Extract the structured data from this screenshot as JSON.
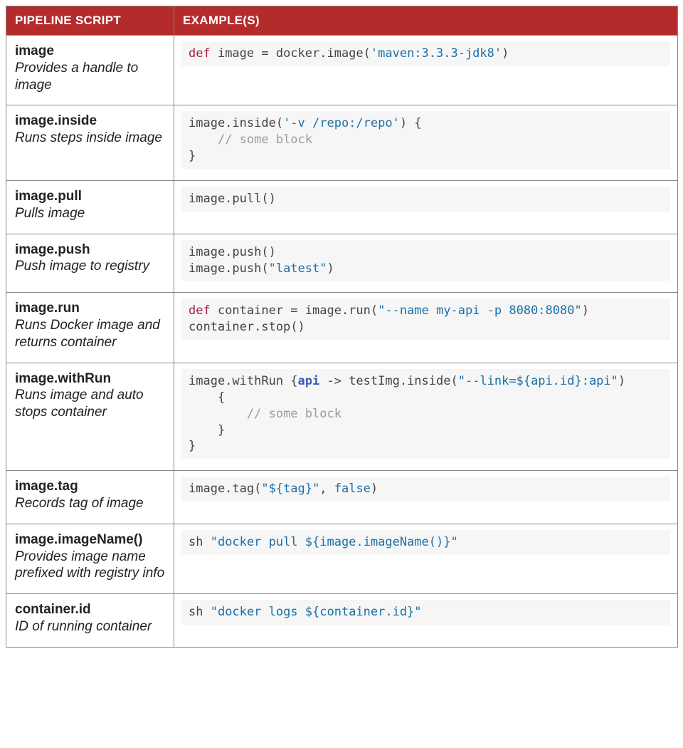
{
  "headers": {
    "script": "PIPELINE SCRIPT",
    "example": "EXAMPLE(S)"
  },
  "rows": [
    {
      "name": "image",
      "desc": "Provides a handle to image",
      "code": [
        [
          {
            "t": "kw",
            "v": "def"
          },
          {
            "t": "p",
            "v": " image = docker.image("
          },
          {
            "t": "str",
            "v": "'maven:3.3.3-jdk8'"
          },
          {
            "t": "p",
            "v": ")"
          }
        ]
      ]
    },
    {
      "name": "image.inside",
      "desc": "Runs steps inside image",
      "code": [
        [
          {
            "t": "p",
            "v": "image.inside("
          },
          {
            "t": "str",
            "v": "'-v /repo:/repo'"
          },
          {
            "t": "p",
            "v": ") {"
          }
        ],
        [
          {
            "t": "p",
            "v": "    "
          },
          {
            "t": "cmt",
            "v": "// some block"
          }
        ],
        [
          {
            "t": "p",
            "v": "}"
          }
        ]
      ]
    },
    {
      "name": "image.pull",
      "desc": "Pulls image",
      "code": [
        [
          {
            "t": "p",
            "v": "image.pull()"
          }
        ]
      ]
    },
    {
      "name": "image.push",
      "desc": "Push image to registry",
      "code": [
        [
          {
            "t": "p",
            "v": "image.push()"
          }
        ],
        [
          {
            "t": "p",
            "v": "image.push("
          },
          {
            "t": "str",
            "v": "\"latest\""
          },
          {
            "t": "p",
            "v": ")"
          }
        ]
      ]
    },
    {
      "name": "image.run",
      "desc": "Runs Docker image and returns container",
      "code": [
        [
          {
            "t": "kw",
            "v": "def"
          },
          {
            "t": "p",
            "v": " container = image.run("
          },
          {
            "t": "str",
            "v": "\"--name my-api -p 8080:8080\""
          },
          {
            "t": "p",
            "v": ")"
          }
        ],
        [
          {
            "t": "p",
            "v": "container.stop()"
          }
        ]
      ]
    },
    {
      "name": "image.withRun",
      "desc": "Runs image and auto stops container",
      "code": [
        [
          {
            "t": "p",
            "v": "image.withRun {"
          },
          {
            "t": "var",
            "v": "api"
          },
          {
            "t": "p",
            "v": " -> testImg.inside("
          },
          {
            "t": "str",
            "v": "\"--link=${api.id}:api\""
          },
          {
            "t": "p",
            "v": ")"
          }
        ],
        [
          {
            "t": "p",
            "v": "    {"
          }
        ],
        [
          {
            "t": "p",
            "v": "        "
          },
          {
            "t": "cmt",
            "v": "// some block"
          }
        ],
        [
          {
            "t": "p",
            "v": "    }"
          }
        ],
        [
          {
            "t": "p",
            "v": "}"
          }
        ]
      ]
    },
    {
      "name": "image.tag",
      "desc": "Records tag of image",
      "code": [
        [
          {
            "t": "p",
            "v": "image.tag("
          },
          {
            "t": "str",
            "v": "\"${tag}\""
          },
          {
            "t": "p",
            "v": ", "
          },
          {
            "t": "bool",
            "v": "false"
          },
          {
            "t": "p",
            "v": ")"
          }
        ]
      ]
    },
    {
      "name": "image.imageName()",
      "desc": "Provides image name prefixed with registry info",
      "code": [
        [
          {
            "t": "p",
            "v": "sh "
          },
          {
            "t": "str",
            "v": "\"docker pull ${image.imageName()}\""
          }
        ]
      ]
    },
    {
      "name": "container.id",
      "desc": "ID of running container",
      "code": [
        [
          {
            "t": "p",
            "v": "sh "
          },
          {
            "t": "str",
            "v": "\"docker logs ${container.id}\""
          }
        ]
      ]
    }
  ]
}
